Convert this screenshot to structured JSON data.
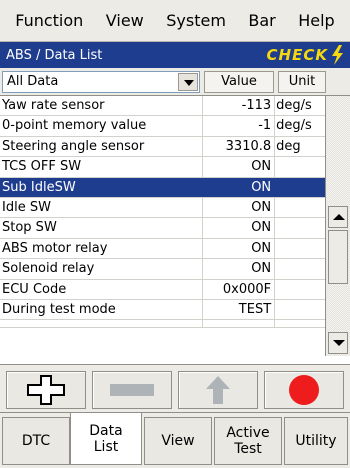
{
  "menu": [
    "Function",
    "View",
    "System",
    "Bar",
    "Help"
  ],
  "title": "ABS / Data List",
  "check_label": "CHECK",
  "filter": {
    "selected": "All Data"
  },
  "columns": {
    "value": "Value",
    "unit": "Unit"
  },
  "rows": [
    {
      "name": "Yaw rate sensor",
      "value": "-113",
      "unit": "deg/s"
    },
    {
      "name": "0-point memory value",
      "value": "-1",
      "unit": "deg/s"
    },
    {
      "name": "Steering angle sensor",
      "value": "3310.8",
      "unit": "deg"
    },
    {
      "name": "TCS OFF SW",
      "value": "ON",
      "unit": ""
    },
    {
      "name": "Sub IdleSW",
      "value": "ON",
      "unit": "",
      "selected": true
    },
    {
      "name": "Idle SW",
      "value": "ON",
      "unit": ""
    },
    {
      "name": "Stop SW",
      "value": "ON",
      "unit": ""
    },
    {
      "name": "ABS motor relay",
      "value": "ON",
      "unit": ""
    },
    {
      "name": "Solenoid relay",
      "value": "ON",
      "unit": ""
    },
    {
      "name": "ECU Code",
      "value": "0x000F",
      "unit": ""
    },
    {
      "name": "During test mode",
      "value": "TEST",
      "unit": ""
    }
  ],
  "actions": {
    "add": "plus-icon",
    "remove": "minus-icon",
    "move_up": "up-arrow-icon",
    "record": "record-icon"
  },
  "tabs": [
    {
      "label": "DTC"
    },
    {
      "label": "Data\nList",
      "line1": "Data",
      "line2": "List",
      "active": true
    },
    {
      "label": "View"
    },
    {
      "label": "Active\nTest",
      "line1": "Active",
      "line2": "Test"
    },
    {
      "label": "Utility"
    }
  ],
  "colors": {
    "titlebar": "#1f3d8e",
    "check": "#f5d80d",
    "selected_row": "#1f3d8e",
    "record": "#ee1c1c"
  }
}
